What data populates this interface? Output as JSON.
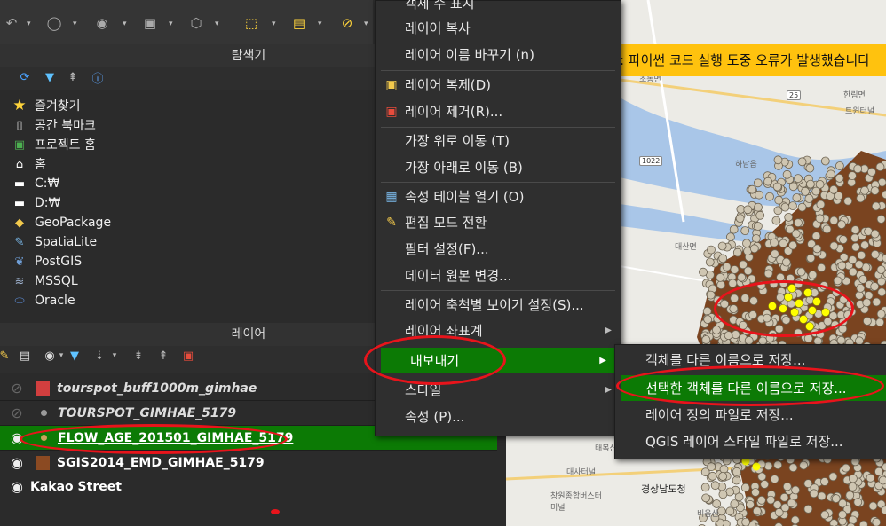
{
  "window": {
    "error_banner": ": 파이썬 코드 실행 도중 오류가 발생했습니다"
  },
  "browser_panel": {
    "title": "탐색기",
    "items": [
      {
        "label": "즐겨찾기",
        "icon": "star-icon"
      },
      {
        "label": "공간 북마크",
        "icon": "bookmark-icon"
      },
      {
        "label": "프로젝트 홈",
        "icon": "project-home-icon"
      },
      {
        "label": "홈",
        "icon": "home-icon"
      },
      {
        "label": "C:₩",
        "icon": "folder-icon"
      },
      {
        "label": "D:₩",
        "icon": "folder-icon"
      },
      {
        "label": "GeoPackage",
        "icon": "geopackage-icon"
      },
      {
        "label": "SpatiaLite",
        "icon": "spatialite-icon"
      },
      {
        "label": "PostGIS",
        "icon": "postgis-icon"
      },
      {
        "label": "MSSQL",
        "icon": "mssql-icon"
      },
      {
        "label": "Oracle",
        "icon": "oracle-icon"
      }
    ]
  },
  "layers_panel": {
    "title": "레이어",
    "layers": [
      {
        "name": "tourspot_buff1000m_gimhae",
        "visible": false,
        "symbol": "polygon",
        "color": "#d23f3f",
        "style": "italic-bold"
      },
      {
        "name": "TOURSPOT_GIMHAE_5179",
        "visible": false,
        "symbol": "point",
        "color": "#9a9a9a",
        "style": "italic-bold"
      },
      {
        "name": "FLOW_AGE_201501_GIMHAE_5179",
        "visible": true,
        "symbol": "point",
        "color": "#c9a25a",
        "style": "selected"
      },
      {
        "name": "SGIS2014_EMD_GIMHAE_5179",
        "visible": true,
        "symbol": "polygon",
        "color": "#8b4a22",
        "style": "bold"
      },
      {
        "name": "Kakao Street",
        "visible": true,
        "symbol": "none",
        "color": "",
        "style": "bold"
      }
    ]
  },
  "context_menu": {
    "items": [
      {
        "label": "객체 수 표시",
        "icon": ""
      },
      {
        "label": "레이어 복사",
        "icon": ""
      },
      {
        "label": "레이어 이름 바꾸기 (n)",
        "icon": ""
      },
      {
        "label": "레이어 복제(D)",
        "icon": "duplicate-layer-icon"
      },
      {
        "label": "레이어 제거(R)...",
        "icon": "remove-layer-icon"
      },
      {
        "label": "가장 위로 이동 (T)",
        "icon": ""
      },
      {
        "label": "가장 아래로 이동 (B)",
        "icon": ""
      },
      {
        "label": "속성 테이블 열기 (O)",
        "icon": "attribute-table-icon"
      },
      {
        "label": "편집 모드 전환",
        "icon": "pencil-icon"
      },
      {
        "label": "필터 설정(F)...",
        "icon": ""
      },
      {
        "label": "데이터 원본 변경...",
        "icon": ""
      },
      {
        "label": "레이어 축척별 보이기 설정(S)...",
        "icon": ""
      },
      {
        "label": "레이어 좌표계",
        "icon": ""
      },
      {
        "label": "내보내기",
        "icon": ""
      },
      {
        "label": "스타일",
        "icon": ""
      },
      {
        "label": "속성 (P)...",
        "icon": ""
      }
    ]
  },
  "export_submenu": {
    "items": [
      {
        "label": "객체를 다른 이름으로 저장..."
      },
      {
        "label": "선택한 객체를 다른 이름으로 저장..."
      },
      {
        "label": "레이어 정의 파일로 저장..."
      },
      {
        "label": "QGIS 레이어 스타일 파일로 저장..."
      }
    ]
  },
  "map_labels": {
    "place_1": "초동면",
    "place_2": "한림면",
    "place_3": "트윈터널",
    "place_4": "하남읍",
    "place_5": "대산면",
    "place_6": "태복산",
    "place_7": "대사터널",
    "place_8": "창원종합버스터미널",
    "place_9": "경상남도청",
    "place_10": "비음산",
    "road_1": "1022",
    "road_2": "25"
  },
  "colors": {
    "selection_green": "#0c7a05",
    "annotation_red": "#e8141b",
    "error_yellow": "#ffc20e",
    "point_fill": "#cfc6b2",
    "selected_point": "#ffff00",
    "polygon_brown": "#7a4420"
  }
}
